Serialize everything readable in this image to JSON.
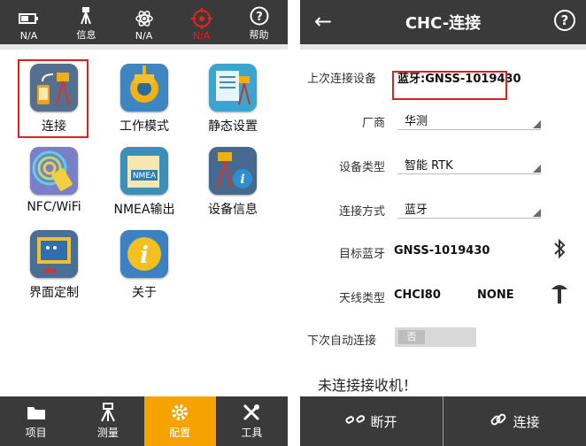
{
  "left": {
    "topbar": [
      {
        "icon": "battery-icon",
        "label": "N/A"
      },
      {
        "icon": "receiver-icon",
        "label": "信息"
      },
      {
        "icon": "satellite-icon",
        "label": "N/A"
      },
      {
        "icon": "target-icon",
        "label": "N/A",
        "color": "#e8211e"
      },
      {
        "icon": "help-icon",
        "label": "帮助"
      }
    ],
    "grid": [
      {
        "label": "连接",
        "icon": "connect-icon"
      },
      {
        "label": "工作模式",
        "icon": "gear-icon"
      },
      {
        "label": "静态设置",
        "icon": "static-settings-icon"
      },
      {
        "label": "NFC/WiFi",
        "icon": "nfc-wifi-icon"
      },
      {
        "label": "NMEA输出",
        "icon": "nmea-icon"
      },
      {
        "label": "设备信息",
        "icon": "device-info-icon"
      },
      {
        "label": "界面定制",
        "icon": "ui-custom-icon"
      },
      {
        "label": "关于",
        "icon": "about-icon"
      }
    ],
    "bottomnav": [
      {
        "label": "项目",
        "icon": "folder-icon"
      },
      {
        "label": "测量",
        "icon": "survey-icon"
      },
      {
        "label": "配置",
        "icon": "gear-icon",
        "active": true
      },
      {
        "label": "工具",
        "icon": "tools-icon"
      }
    ]
  },
  "right": {
    "header": {
      "title": "CHC-连接",
      "back": "←",
      "help": "?"
    },
    "last_device_label": "上次连接设备",
    "last_device_value": "蓝牙:GNSS-1019430",
    "manufacturer_label": "厂商",
    "manufacturer_value": "华测",
    "device_type_label": "设备类型",
    "device_type_value": "智能 RTK",
    "connect_method_label": "连接方式",
    "connect_method_value": "蓝牙",
    "target_bt_label": "目标蓝牙",
    "target_bt_value": "GNSS-1019430",
    "antenna_label": "天线类型",
    "antenna_value": "CHCI80",
    "antenna_value2": "NONE",
    "auto_connect_label": "下次自动连接",
    "auto_connect_state": "否",
    "status_text": "未连接接收机！",
    "disconnect_label": "断开",
    "connect_label": "连接"
  }
}
